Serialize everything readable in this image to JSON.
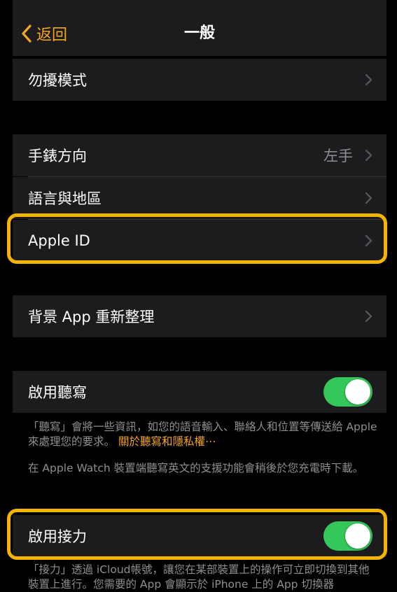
{
  "navbar": {
    "back_label": "返回",
    "title": "一般"
  },
  "rows": {
    "dnd": "勿擾模式",
    "orientation": "手錶方向",
    "orientation_value": "左手",
    "language": "語言與地區",
    "apple_id": "Apple ID",
    "bg_refresh": "背景 App 重新整理",
    "dictation": "啟用聽寫",
    "handoff": "啟用接力"
  },
  "toggles": {
    "dictation_on": true,
    "handoff_on": true
  },
  "footnotes": {
    "dictation_text": "「聽寫」會將一些資訊，如您的語音輸入、聯絡人和位置等傳送給 Apple 來處理您的要求。",
    "dictation_link": "關於聽寫和隱私權⋯",
    "watch_text": "在 Apple Watch 裝置端聽寫英文的支援功能會稍後於您充電時下載。",
    "handoff_text": "「接力」透過 iCloud帳號，讓您在某部裝置上的操作可立即切換到其他裝置上進行。您需要的 App 會顯示於 iPhone 上的 App 切換器"
  },
  "colors": {
    "accent": "#f5a623",
    "highlight": "#f4b400",
    "toggle_on": "#34c759",
    "cell_bg": "#1c1c1e"
  }
}
